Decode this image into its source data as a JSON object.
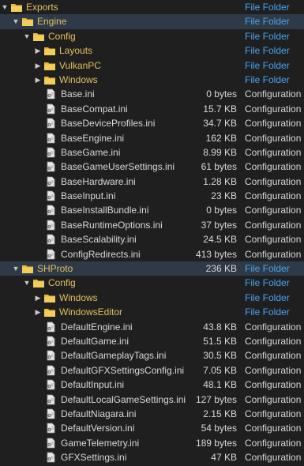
{
  "rows": [
    {
      "id": "exports",
      "depth": 0,
      "kind": "folder",
      "expanded": true,
      "name": "Exports",
      "size": "",
      "type": "File Folder"
    },
    {
      "id": "engine",
      "depth": 1,
      "kind": "folder",
      "expanded": true,
      "selected": true,
      "name": "Engine",
      "size": "",
      "type": "File Folder"
    },
    {
      "id": "engine-config",
      "depth": 2,
      "kind": "folder",
      "expanded": true,
      "name": "Config",
      "size": "",
      "type": "File Folder"
    },
    {
      "id": "layouts",
      "depth": 3,
      "kind": "folder",
      "expanded": false,
      "name": "Layouts",
      "size": "",
      "type": "File Folder"
    },
    {
      "id": "vulkanpc",
      "depth": 3,
      "kind": "folder",
      "expanded": false,
      "name": "VulkanPC",
      "size": "",
      "type": "File Folder"
    },
    {
      "id": "windows1",
      "depth": 3,
      "kind": "folder",
      "expanded": false,
      "name": "Windows",
      "size": "",
      "type": "File Folder"
    },
    {
      "id": "base",
      "depth": 3,
      "kind": "file",
      "name": "Base.ini",
      "size": "0 bytes",
      "type": "Configuration"
    },
    {
      "id": "basecompat",
      "depth": 3,
      "kind": "file",
      "name": "BaseCompat.ini",
      "size": "15.7 KB",
      "type": "Configuration"
    },
    {
      "id": "basedeviceprofiles",
      "depth": 3,
      "kind": "file",
      "name": "BaseDeviceProfiles.ini",
      "size": "34.7 KB",
      "type": "Configuration"
    },
    {
      "id": "baseengine",
      "depth": 3,
      "kind": "file",
      "name": "BaseEngine.ini",
      "size": "162 KB",
      "type": "Configuration"
    },
    {
      "id": "basegame",
      "depth": 3,
      "kind": "file",
      "name": "BaseGame.ini",
      "size": "8.99 KB",
      "type": "Configuration"
    },
    {
      "id": "basegameusersettings",
      "depth": 3,
      "kind": "file",
      "name": "BaseGameUserSettings.ini",
      "size": "61 bytes",
      "type": "Configuration"
    },
    {
      "id": "basehardware",
      "depth": 3,
      "kind": "file",
      "name": "BaseHardware.ini",
      "size": "1.28 KB",
      "type": "Configuration"
    },
    {
      "id": "baseinput",
      "depth": 3,
      "kind": "file",
      "name": "BaseInput.ini",
      "size": "23 KB",
      "type": "Configuration"
    },
    {
      "id": "baseinstallbundle",
      "depth": 3,
      "kind": "file",
      "name": "BaseInstallBundle.ini",
      "size": "0 bytes",
      "type": "Configuration"
    },
    {
      "id": "baseruntimeoptions",
      "depth": 3,
      "kind": "file",
      "name": "BaseRuntimeOptions.ini",
      "size": "37 bytes",
      "type": "Configuration"
    },
    {
      "id": "basescalability",
      "depth": 3,
      "kind": "file",
      "name": "BaseScalability.ini",
      "size": "24.5 KB",
      "type": "Configuration"
    },
    {
      "id": "configredirects",
      "depth": 3,
      "kind": "file",
      "name": "ConfigRedirects.ini",
      "size": "413 bytes",
      "type": "Configuration"
    },
    {
      "id": "shproto",
      "depth": 1,
      "kind": "folder",
      "expanded": true,
      "selected": true,
      "name": "SHProto",
      "size": "236 KB",
      "type": "File Folder"
    },
    {
      "id": "shproto-config",
      "depth": 2,
      "kind": "folder",
      "expanded": true,
      "name": "Config",
      "size": "",
      "type": "File Folder"
    },
    {
      "id": "windows2",
      "depth": 3,
      "kind": "folder",
      "expanded": false,
      "name": "Windows",
      "size": "",
      "type": "File Folder"
    },
    {
      "id": "windowseditor",
      "depth": 3,
      "kind": "folder",
      "expanded": false,
      "name": "WindowsEditor",
      "size": "",
      "type": "File Folder"
    },
    {
      "id": "defaultengine",
      "depth": 3,
      "kind": "file",
      "name": "DefaultEngine.ini",
      "size": "43.8 KB",
      "type": "Configuration"
    },
    {
      "id": "defaultgame",
      "depth": 3,
      "kind": "file",
      "name": "DefaultGame.ini",
      "size": "51.5 KB",
      "type": "Configuration"
    },
    {
      "id": "defaultgameplaytags",
      "depth": 3,
      "kind": "file",
      "name": "DefaultGameplayTags.ini",
      "size": "30.5 KB",
      "type": "Configuration"
    },
    {
      "id": "defaultgfxsettingsconfig",
      "depth": 3,
      "kind": "file",
      "name": "DefaultGFXSettingsConfig.ini",
      "size": "7.05 KB",
      "type": "Configuration"
    },
    {
      "id": "defaultinput",
      "depth": 3,
      "kind": "file",
      "name": "DefaultInput.ini",
      "size": "48.1 KB",
      "type": "Configuration"
    },
    {
      "id": "defaultlocalgamesettings",
      "depth": 3,
      "kind": "file",
      "name": "DefaultLocalGameSettings.ini",
      "size": "127 bytes",
      "type": "Configuration"
    },
    {
      "id": "defaultniagara",
      "depth": 3,
      "kind": "file",
      "name": "DefaultNiagara.ini",
      "size": "2.15 KB",
      "type": "Configuration"
    },
    {
      "id": "defaultversion",
      "depth": 3,
      "kind": "file",
      "name": "DefaultVersion.ini",
      "size": "54 bytes",
      "type": "Configuration"
    },
    {
      "id": "gametelemetry",
      "depth": 3,
      "kind": "file",
      "name": "GameTelemetry.ini",
      "size": "189 bytes",
      "type": "Configuration"
    },
    {
      "id": "gfxsettings",
      "depth": 3,
      "kind": "file",
      "name": "GFXSettings.ini",
      "size": "47 KB",
      "type": "Configuration"
    }
  ],
  "colors": {
    "background": "#1f1f1f",
    "selected_row": "#2f3a48",
    "folder_icon": "#e8b93c",
    "folder_type_text": "#4aa3f0",
    "text": "#d8d8d8"
  },
  "icons": {
    "folder": "folder-icon",
    "file": "ini-file-icon",
    "expanded": "chevron-down-icon",
    "collapsed": "chevron-right-icon"
  }
}
